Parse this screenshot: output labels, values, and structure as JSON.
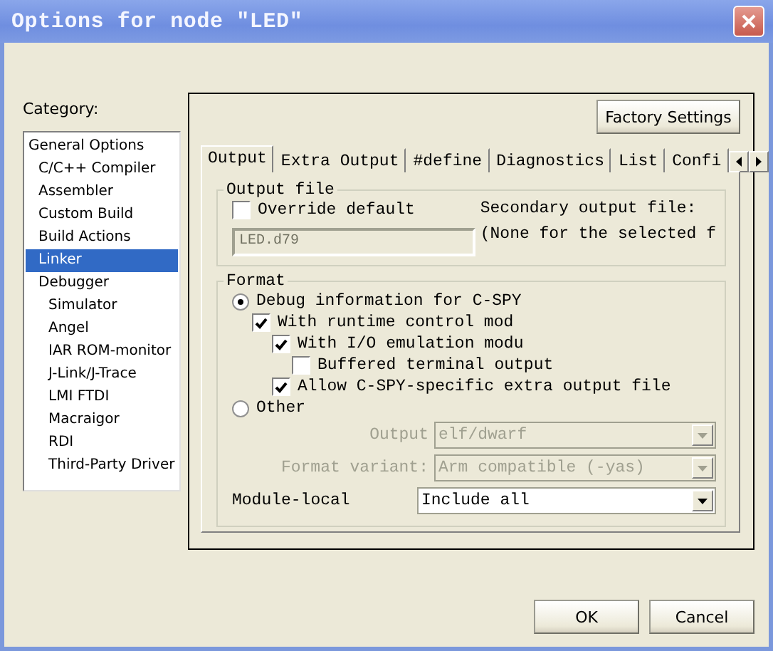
{
  "window": {
    "title": "Options for node \"LED\""
  },
  "category": {
    "label": "Category:",
    "items": [
      {
        "label": "General Options",
        "selected": false,
        "children": [
          {
            "label": "C/C++ Compiler",
            "selected": false
          },
          {
            "label": "Assembler",
            "selected": false
          },
          {
            "label": "Custom Build",
            "selected": false
          },
          {
            "label": "Build Actions",
            "selected": false
          },
          {
            "label": "Linker",
            "selected": true
          },
          {
            "label": "Debugger",
            "selected": false,
            "children": [
              {
                "label": "Simulator",
                "selected": false
              },
              {
                "label": "Angel",
                "selected": false
              },
              {
                "label": "IAR ROM-monitor",
                "selected": false
              },
              {
                "label": "J-Link/J-Trace",
                "selected": false
              },
              {
                "label": "LMI FTDI",
                "selected": false
              },
              {
                "label": "Macraigor",
                "selected": false
              },
              {
                "label": "RDI",
                "selected": false
              },
              {
                "label": "Third-Party Driver",
                "selected": false
              }
            ]
          }
        ]
      }
    ]
  },
  "factory_button": "Factory Settings",
  "tabs": [
    {
      "label": "Output",
      "selected": true
    },
    {
      "label": "Extra Output",
      "selected": false
    },
    {
      "label": "#define",
      "selected": false
    },
    {
      "label": "Diagnostics",
      "selected": false
    },
    {
      "label": "List",
      "selected": false
    },
    {
      "label": "Confi",
      "selected": false
    }
  ],
  "output_file": {
    "title": "Output file",
    "override": {
      "label": "Override default",
      "checked": false
    },
    "filename": {
      "value": "LED.d79",
      "disabled": true
    },
    "secondary_label": "Secondary output file:",
    "secondary_value": "(None for the selected f"
  },
  "format": {
    "title": "Format",
    "options": [
      {
        "kind": "radio",
        "label": "Debug information for C-SPY",
        "selected": true,
        "children": [
          {
            "kind": "checkbox",
            "label": "With runtime control mod",
            "checked": true,
            "children": [
              {
                "kind": "checkbox",
                "label": "With I/O emulation modu",
                "checked": true,
                "children": [
                  {
                    "kind": "checkbox",
                    "label": "Buffered terminal output",
                    "checked": false
                  }
                ]
              },
              {
                "kind": "checkbox",
                "label": "Allow C-SPY-specific extra output file",
                "checked": true
              }
            ]
          }
        ]
      },
      {
        "kind": "radio",
        "label": "Other",
        "selected": false
      }
    ],
    "other_fields": [
      {
        "label": "Output",
        "value": "elf/dwarf",
        "disabled": true
      },
      {
        "label": "Format variant:",
        "value": "Arm compatible (-yas)",
        "disabled": true
      }
    ],
    "module_local": {
      "label": "Module-local",
      "value": "Include all",
      "disabled": false
    }
  },
  "buttons": [
    "OK",
    "Cancel"
  ]
}
